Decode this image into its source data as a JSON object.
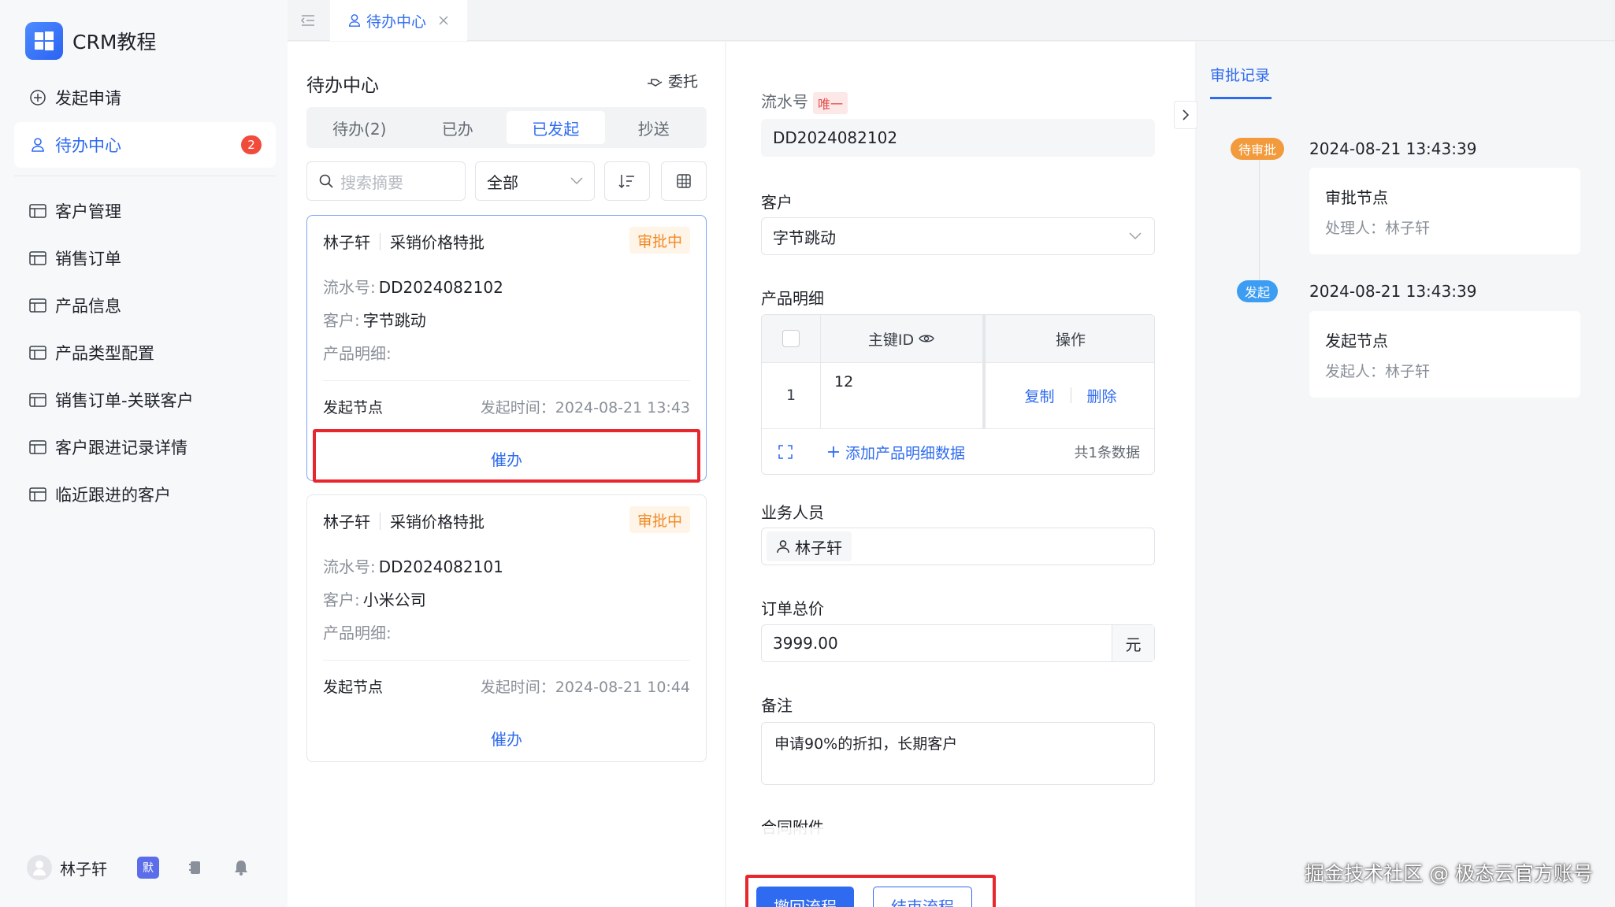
{
  "app": {
    "title": "CRM教程"
  },
  "sidebar": {
    "items": [
      {
        "label": "发起申请",
        "icon": "plus-circle-icon"
      },
      {
        "label": "待办中心",
        "icon": "user-icon",
        "badge": "2"
      },
      {
        "label": "客户管理",
        "icon": "table-icon"
      },
      {
        "label": "销售订单",
        "icon": "table-icon"
      },
      {
        "label": "产品信息",
        "icon": "table-icon"
      },
      {
        "label": "产品类型配置",
        "icon": "table-icon"
      },
      {
        "label": "销售订单-关联客户",
        "icon": "table-icon"
      },
      {
        "label": "客户跟进记录详情",
        "icon": "table-icon"
      },
      {
        "label": "临近跟进的客户",
        "icon": "table-icon"
      }
    ],
    "user": {
      "name": "林子轩",
      "tag": "默"
    }
  },
  "tabs": [
    {
      "label": "待办中心"
    }
  ],
  "list": {
    "title": "待办中心",
    "delegate": "委托",
    "segments": [
      "待办(2)",
      "已办",
      "已发起",
      "抄送"
    ],
    "search_placeholder": "搜索摘要",
    "filter_value": "全部",
    "cards": [
      {
        "applicant": "林子轩",
        "name": "采销价格特批",
        "status": "审批中",
        "serial_label": "流水号:",
        "serial": "DD2024082102",
        "customer_label": "客户:",
        "customer": "字节跳动",
        "detail_label": "产品明细:",
        "node": "发起节点",
        "time": "发起时间：2024-08-21 13:43",
        "urge": "催办"
      },
      {
        "applicant": "林子轩",
        "name": "采销价格特批",
        "status": "审批中",
        "serial_label": "流水号:",
        "serial": "DD2024082101",
        "customer_label": "客户:",
        "customer": "小米公司",
        "detail_label": "产品明细:",
        "node": "发起节点",
        "time": "发起时间：2024-08-21 10:44",
        "urge": "催办"
      }
    ]
  },
  "form": {
    "serial_label": "流水号",
    "unique_tag": "唯一",
    "serial_value": "DD2024082102",
    "customer_label": "客户",
    "customer_value": "字节跳动",
    "detail_label": "产品明细",
    "table": {
      "col_id": "主键ID",
      "col_action": "操作",
      "rows": [
        {
          "index": "1",
          "id": "12",
          "copy": "复制",
          "delete": "删除"
        }
      ],
      "add_label": "添加产品明细数据",
      "count": "共1条数据"
    },
    "sales_label": "业务人员",
    "sales_value": "林子轩",
    "price_label": "订单总价",
    "price_value": "3999.00",
    "price_unit": "元",
    "remark_label": "备注",
    "remark_value": "申请90%的折扣，长期客户",
    "attach_label": "合同附件",
    "withdraw_button": "撤回流程",
    "end_button": "结束流程"
  },
  "records": {
    "tab": "审批记录",
    "items": [
      {
        "tag": "待审批",
        "tag_color": "#f29a3c",
        "time": "2024-08-21 13:43:39",
        "node": "审批节点",
        "person": "处理人：林子轩"
      },
      {
        "tag": "发起",
        "tag_color": "#3d9df2",
        "time": "2024-08-21 13:43:39",
        "node": "发起节点",
        "person": "发起人：林子轩"
      }
    ]
  },
  "watermark": "掘金技术社区 @ 极态云官方账号"
}
